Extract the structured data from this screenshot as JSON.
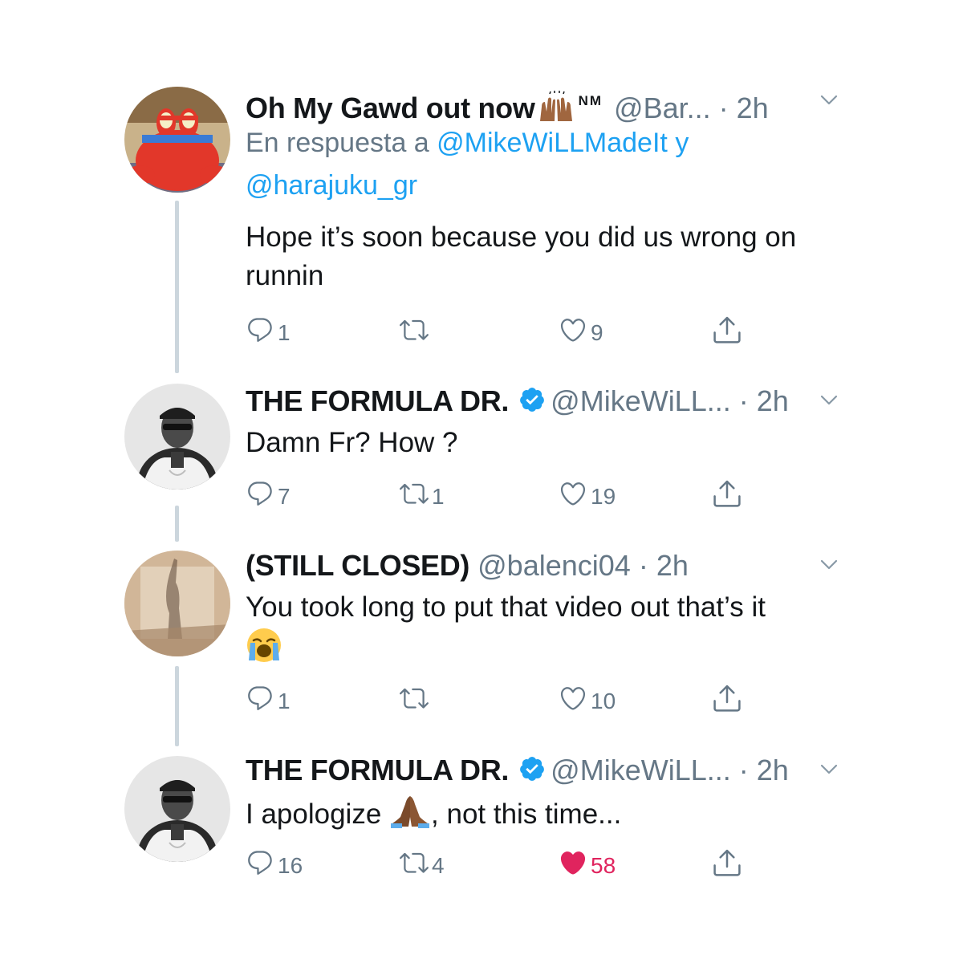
{
  "tweets": [
    {
      "name": "Oh My Gawd out now",
      "name_suffix": "NM",
      "handle": "@Bar...",
      "time": "· 2h",
      "reply_prefix": "En respuesta a",
      "reply_user1": "@MikeWiLLMadeIt",
      "reply_join": "y",
      "reply_user2": "@harajuku_gr",
      "text": "Hope it’s soon because you did us wrong on runnin",
      "replies": "1",
      "retweets": "",
      "likes": "9",
      "liked": false
    },
    {
      "name": "THE FORMULA DR.",
      "verified": true,
      "handle": "@MikeWiLL...",
      "time": "· 2h",
      "text": "Damn Fr? How ?",
      "replies": "7",
      "retweets": "1",
      "likes": "19",
      "liked": false
    },
    {
      "name": "(STILL CLOSED)",
      "handle": "@balenci04",
      "time": "· 2h",
      "text": "You took long to put that video out that’s it",
      "emoji": "crying-face",
      "replies": "1",
      "retweets": "",
      "likes": "10",
      "liked": false
    },
    {
      "name": "THE FORMULA DR.",
      "verified": true,
      "handle": "@MikeWiLL...",
      "time": "· 2h",
      "text_before_emoji": "I apologize",
      "emoji": "praying-hands",
      "text_after_emoji": ", not this time...",
      "replies": "16",
      "retweets": "4",
      "likes": "58",
      "liked": true
    }
  ],
  "colors": {
    "text": "#14171a",
    "secondary": "#657786",
    "link": "#1da1f2",
    "like": "#e0245e",
    "thread_line": "#ccd6dd",
    "verified": "#1da1f2"
  },
  "icons": [
    "reply-icon",
    "retweet-icon",
    "like-icon",
    "share-icon",
    "chevron-down-icon",
    "verified-badge-icon"
  ]
}
